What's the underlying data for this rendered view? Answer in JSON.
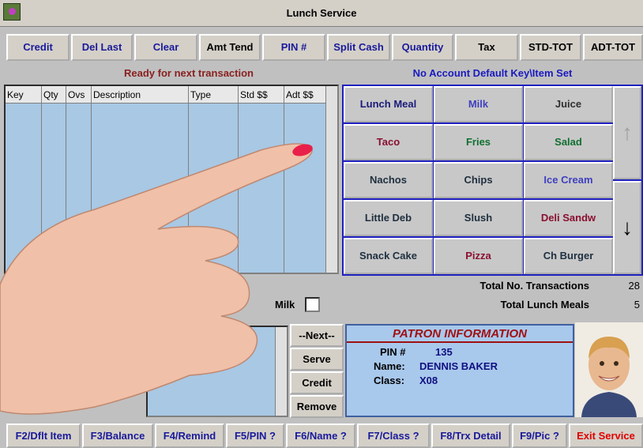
{
  "window": {
    "title": "Lunch Service"
  },
  "toolbar": {
    "credit": "Credit",
    "del_last": "Del Last",
    "clear": "Clear",
    "amt_tend": "Amt Tend",
    "pin": "PIN #",
    "split_cash": "Split Cash",
    "quantity": "Quantity",
    "tax": "Tax",
    "std_tot": "STD-TOT",
    "adt_tot": "ADT-TOT"
  },
  "status": {
    "left": "Ready for next transaction",
    "right": "No Account Default Key\\Item Set"
  },
  "grid": {
    "columns": [
      "Key",
      "Qty",
      "Ovs",
      "Description",
      "Type",
      "Std $$",
      "Adt $$"
    ]
  },
  "keypad": {
    "items": [
      {
        "label": "Lunch Meal",
        "color": "#1a1a7a"
      },
      {
        "label": "Milk",
        "color": "#4040c0"
      },
      {
        "label": "Juice",
        "color": "#303030"
      },
      {
        "label": "Taco",
        "color": "#8a1030"
      },
      {
        "label": "Fries",
        "color": "#107030"
      },
      {
        "label": "Salad",
        "color": "#107030"
      },
      {
        "label": "Nachos",
        "color": "#203040"
      },
      {
        "label": "Chips",
        "color": "#203040"
      },
      {
        "label": "Ice Cream",
        "color": "#4040c0"
      },
      {
        "label": "Little Deb",
        "color": "#203040"
      },
      {
        "label": "Slush",
        "color": "#203040"
      },
      {
        "label": "Deli Sandw",
        "color": "#8a1030"
      },
      {
        "label": "Snack Cake",
        "color": "#203040"
      },
      {
        "label": "Pizza",
        "color": "#8a1030"
      },
      {
        "label": "Ch Burger",
        "color": "#203040"
      }
    ],
    "up_icon": "arrow-up-icon",
    "down_icon": "arrow-down-icon"
  },
  "stats": {
    "transactions_label": "Total No. Transactions",
    "transactions_value": "28",
    "meals_label": "Total Lunch Meals",
    "meals_value": "5",
    "milk_label": "Milk"
  },
  "side_buttons": {
    "next": "--Next--",
    "serve": "Serve",
    "credit": "Credit",
    "remove": "Remove"
  },
  "patron": {
    "title": "PATRON INFORMATION",
    "pin_label": "PIN #",
    "pin_value": "135",
    "name_label": "Name:",
    "name_value": "DENNIS BAKER",
    "class_label": "Class:",
    "class_value": "X08"
  },
  "function_keys": {
    "f2": "F2/Dflt Item",
    "f3": "F3/Balance",
    "f4": "F4/Remind",
    "f5": "F5/PIN ?",
    "f6": "F6/Name ?",
    "f7": "F7/Class ?",
    "f8": "F8/Trx Detail",
    "f9": "F9/Pic ?",
    "exit": "Exit Service"
  }
}
